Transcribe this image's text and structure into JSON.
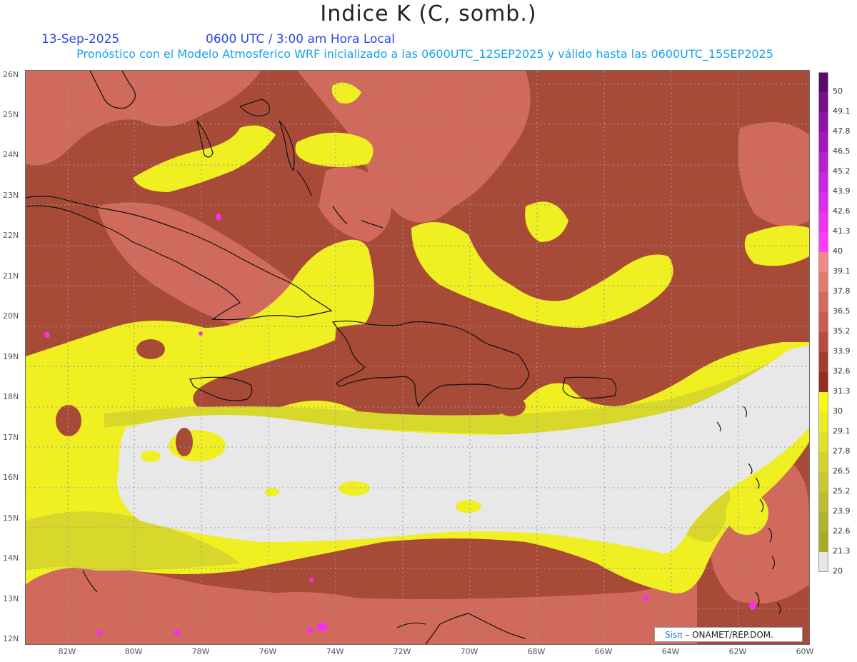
{
  "header": {
    "title": "Indice K (C, somb.)",
    "date": "13-Sep-2025",
    "valid_time": "0600 UTC / 3:00 am Hora Local",
    "subtitle": "Pronóstico con el Modelo Atmosferico WRF inicializado a las 0600UTC_12SEP2025 y válido hasta las  0600UTC_15SEP2025"
  },
  "axes": {
    "lat_labels": [
      "26N",
      "25N",
      "24N",
      "23N",
      "22N",
      "21N",
      "20N",
      "19N",
      "18N",
      "17N",
      "16N",
      "15N",
      "14N",
      "13N",
      "12N"
    ],
    "lon_labels": [
      "82W",
      "80W",
      "78W",
      "76W",
      "74W",
      "72W",
      "70W",
      "68W",
      "66W",
      "64W",
      "62W",
      "60W"
    ]
  },
  "colorbar": {
    "labels": [
      "50",
      "49.1",
      "47.8",
      "46.5",
      "45.2",
      "43.9",
      "42.6",
      "41.3",
      "40",
      "39.1",
      "37.8",
      "36.5",
      "35.2",
      "33.9",
      "32.6",
      "31.3",
      "30",
      "29.1",
      "27.8",
      "26.5",
      "25.2",
      "23.9",
      "22.6",
      "21.3",
      "20"
    ],
    "colors": [
      "#5b0a6b",
      "#7a0f8a",
      "#8f14a3",
      "#a418bb",
      "#b81fd0",
      "#cc25e0",
      "#dd2cea",
      "#ee33f2",
      "#ff3cfa",
      "#f08a85",
      "#e47a72",
      "#d66a60",
      "#c85c50",
      "#b84c3e",
      "#a53e2e",
      "#922f20",
      "#f7f71a",
      "#ecec22",
      "#e0e028",
      "#d3d32c",
      "#c8c830",
      "#bdbd2e",
      "#b3b32c",
      "#aaaa2a",
      "#e6e6e6"
    ]
  },
  "map_colors": {
    "k_gt_35": "#cf6a5c",
    "k_30_35": "#a84a38",
    "k_25_30": "#efef22",
    "k_20_25": "#d8d82c",
    "k_lt_20": "#e8e8e8",
    "k_gt_40": "#f033e8",
    "coastline": "#111111",
    "gridline": "#9a9a9a"
  },
  "credit": {
    "brand": "Sisπ",
    "text": "– ONAMET/REP.DOM."
  }
}
